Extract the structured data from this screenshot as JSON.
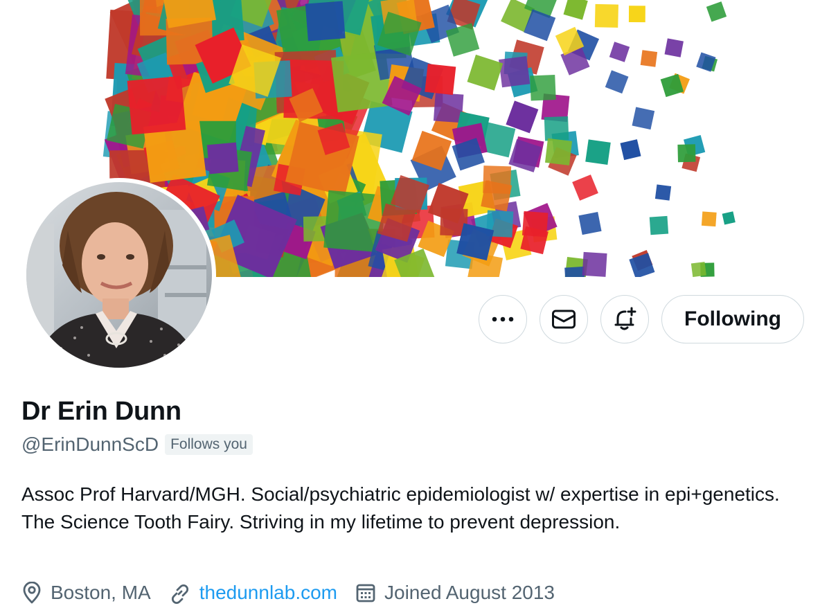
{
  "profile": {
    "display_name": "Dr Erin Dunn",
    "handle": "@ErinDunnScD",
    "follows_you_badge": "Follows you",
    "bio": "Assoc Prof Harvard/MGH. Social/psychiatric epidemiologist w/ expertise in epi+genetics. The Science Tooth Fairy. Striving in my lifetime to prevent depression.",
    "location": "Boston, MA",
    "website": "thedunnlab.com",
    "joined": "Joined August 2013"
  },
  "actions": {
    "more_icon": "more-dots-icon",
    "message_icon": "envelope-icon",
    "notify_icon": "bell-plus-icon",
    "follow_label": "Following"
  },
  "meta_icons": {
    "location": "location-pin-icon",
    "website": "link-icon",
    "joined": "calendar-icon"
  },
  "colors": {
    "link": "#1d9bf0",
    "secondary_text": "#536471",
    "primary_text": "#0f1419",
    "border": "#cfd9de",
    "badge_bg": "#eff3f4"
  }
}
